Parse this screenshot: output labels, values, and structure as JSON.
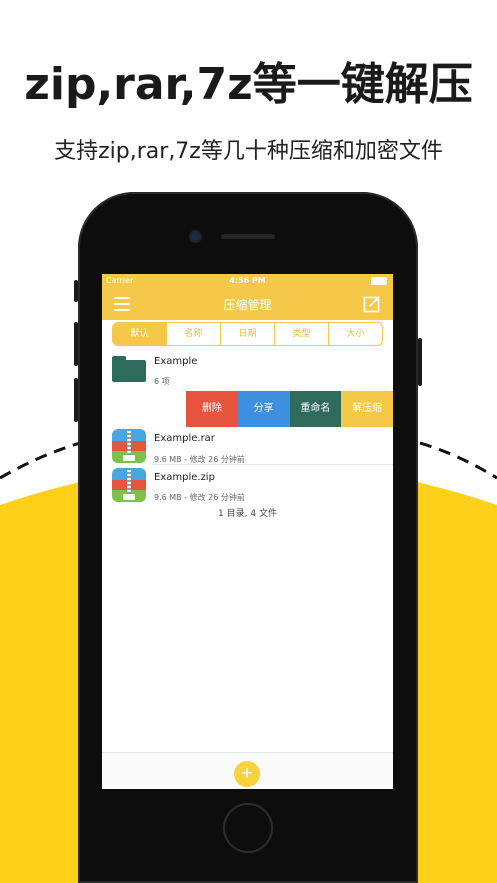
{
  "headline": "zip,rar,7z等一键解压",
  "subheadline": "支持zip,rar,7z等几十种压缩和加密文件",
  "status_bar": {
    "carrier": "Carrier",
    "time": "4:56 PM"
  },
  "nav": {
    "title": "压缩管理"
  },
  "sort_tabs": [
    "默认",
    "名称",
    "日期",
    "类型",
    "大小"
  ],
  "folder": {
    "name": "Example",
    "count": "6 项"
  },
  "swipe_actions": [
    {
      "label": "删除",
      "color": "#e8553f"
    },
    {
      "label": "分享",
      "color": "#3d8fe0"
    },
    {
      "label": "重命名",
      "color": "#2f6b5a"
    },
    {
      "label": "解压缩",
      "color": "#f5c84a"
    }
  ],
  "files": [
    {
      "name": "Example.rar",
      "meta": "9.6 MB - 修改 26 分钟前"
    },
    {
      "name": "Example.zip",
      "meta": "9.6 MB - 修改 26 分钟前"
    }
  ],
  "summary": "1 目录, 4 文件",
  "bottom": {
    "add_label": "+"
  },
  "colors": {
    "accent": "#f5c84a",
    "folder": "#2f6b5a",
    "background_yellow": "#fdd01a"
  }
}
